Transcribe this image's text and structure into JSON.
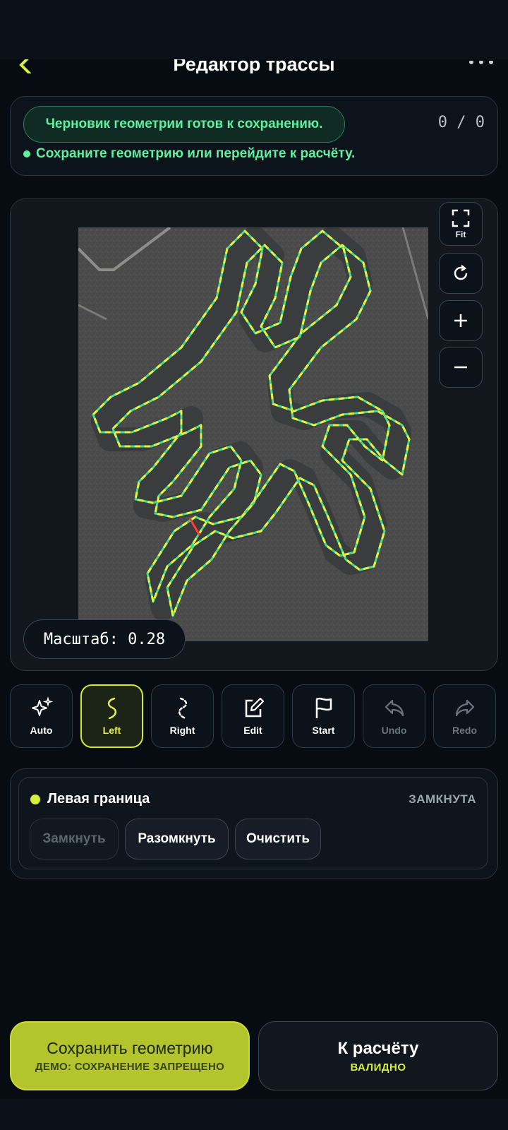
{
  "header": {
    "title": "Редактор трассы"
  },
  "status": {
    "message": "Черновик геометрии готов к сохранению.",
    "counter": "0 / 0",
    "hint": "Сохраните геометрию или перейдите к расчёту."
  },
  "map": {
    "fit_label": "Fit",
    "scale_text": "Масштаб: 0.28"
  },
  "tools": [
    {
      "label": "Auto",
      "icon": "sparkles-icon",
      "state": "normal"
    },
    {
      "label": "Left",
      "icon": "left-boundary-icon",
      "state": "active"
    },
    {
      "label": "Right",
      "icon": "right-boundary-icon",
      "state": "normal"
    },
    {
      "label": "Edit",
      "icon": "edit-icon",
      "state": "normal"
    },
    {
      "label": "Start",
      "icon": "flag-icon",
      "state": "normal"
    },
    {
      "label": "Undo",
      "icon": "undo-icon",
      "state": "disabled"
    },
    {
      "label": "Redo",
      "icon": "redo-icon",
      "state": "disabled"
    }
  ],
  "boundary": {
    "title": "Левая граница",
    "state": "ЗАМКНУТА",
    "close_label": "Замкнуть",
    "open_label": "Разомкнуть",
    "clear_label": "Очистить"
  },
  "actions": {
    "save_label": "Сохранить геометрию",
    "save_sub": "ДЕМО: СОХРАНЕНИЕ ЗАПРЕЩЕНО",
    "calc_label": "К расчёту",
    "calc_sub": "ВАЛИДНО"
  },
  "colors": {
    "accent": "#d6ef3a",
    "success": "#5ff0a0",
    "left_boundary": "#e7f23c",
    "right_boundary": "#3fe08f"
  }
}
